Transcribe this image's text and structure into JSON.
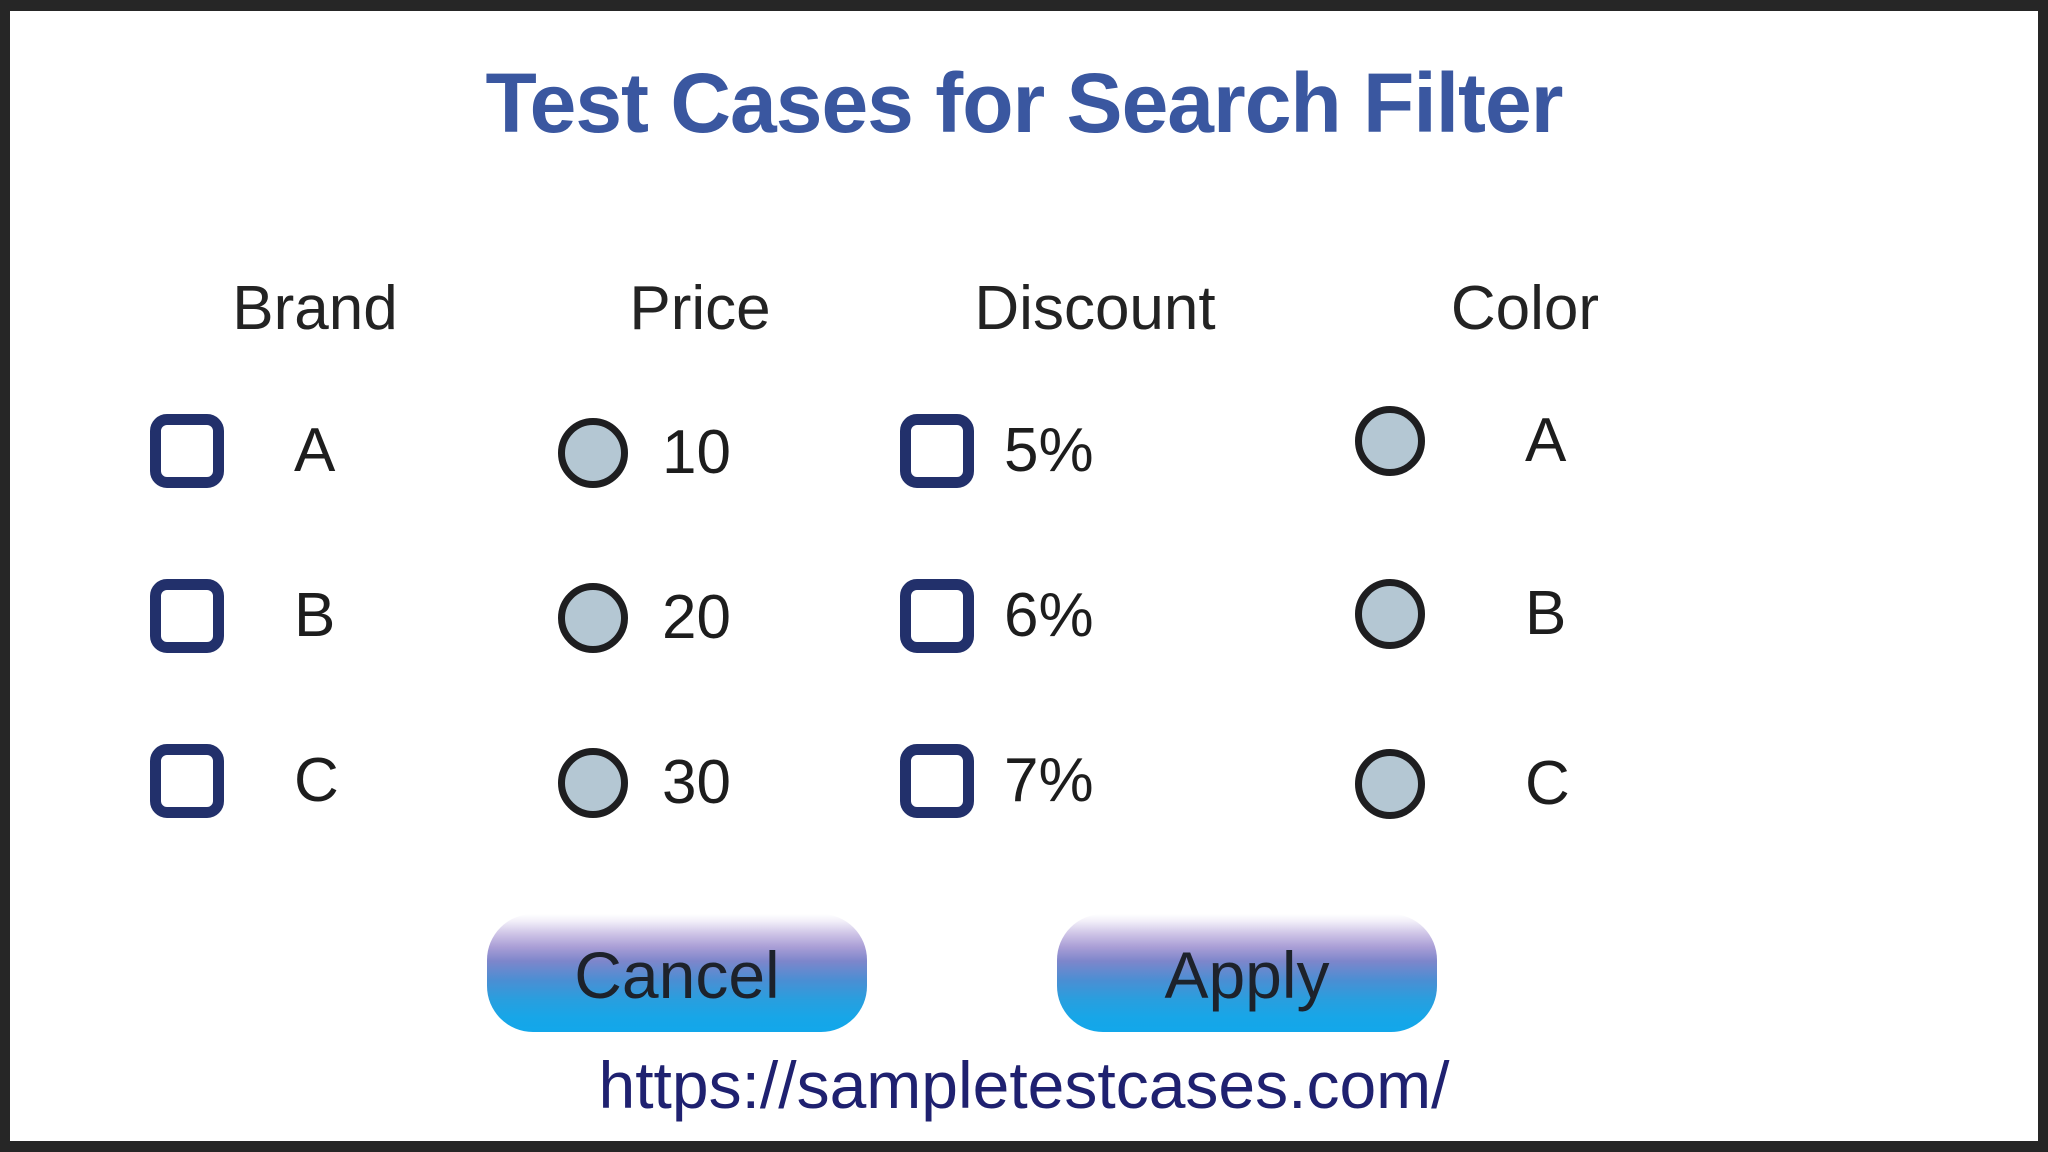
{
  "page": {
    "title": "Test Cases for Search Filter",
    "url": "https://sampletestcases.com/",
    "title_color": "#3A57A0",
    "url_color": "#1F2170",
    "checkbox_border_color": "#22306B",
    "radio_fill_color": "#B4C7D3",
    "radio_border_color": "#1E1E20",
    "frame_color": "#262626",
    "background_color": "#FFFFFF"
  },
  "columns": [
    {
      "header": "Brand",
      "control": "checkbox",
      "options": [
        "A",
        "B",
        "C"
      ]
    },
    {
      "header": "Price",
      "control": "radio",
      "options": [
        "10",
        "20",
        "30"
      ]
    },
    {
      "header": "Discount",
      "control": "checkbox",
      "options": [
        "5%",
        "6%",
        "7%"
      ]
    },
    {
      "header": "Color",
      "control": "radio",
      "options": [
        "A",
        "B",
        "C"
      ]
    }
  ],
  "actions": {
    "cancel_label": "Cancel",
    "apply_label": "Apply"
  }
}
